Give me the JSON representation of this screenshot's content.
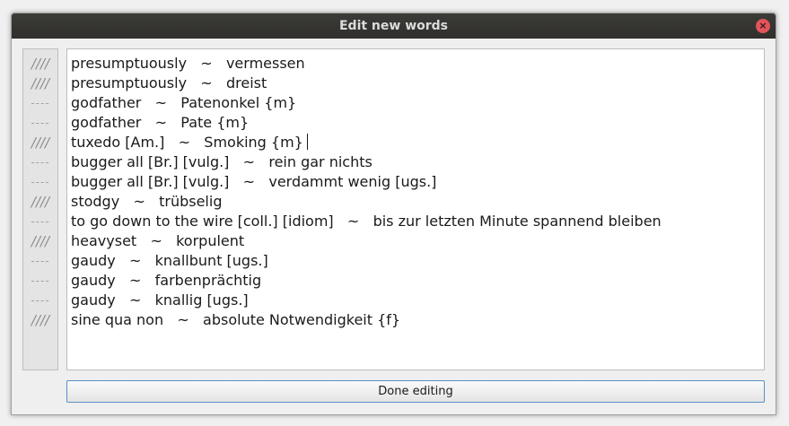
{
  "window": {
    "title": "Edit new words",
    "close_glyph": "×"
  },
  "gutter": {
    "markers": [
      "////",
      "////",
      "----",
      "----",
      "////",
      "----",
      "----",
      "////",
      "----",
      "////",
      "----",
      "----",
      "----",
      "////"
    ]
  },
  "editor": {
    "lines": [
      "presumptuously   ~   vermessen",
      "presumptuously   ~   dreist",
      "godfather   ~   Patenonkel {m}",
      "godfather   ~   Pate {m}",
      "tuxedo [Am.]   ~   Smoking {m}",
      "bugger all [Br.] [vulg.]   ~   rein gar nichts",
      "bugger all [Br.] [vulg.]   ~   verdammt wenig [ugs.]",
      "stodgy   ~   trübselig",
      "to go down to the wire [coll.] [idiom]   ~   bis zur letzten Minute spannend bleiben",
      "heavyset   ~   korpulent",
      "gaudy   ~   knallbunt [ugs.]",
      "gaudy   ~   farbenprächtig",
      "gaudy   ~   knallig [ugs.]",
      "sine qua non   ~   absolute Notwendigkeit {f}"
    ]
  },
  "footer": {
    "done_label": "Done editing"
  }
}
